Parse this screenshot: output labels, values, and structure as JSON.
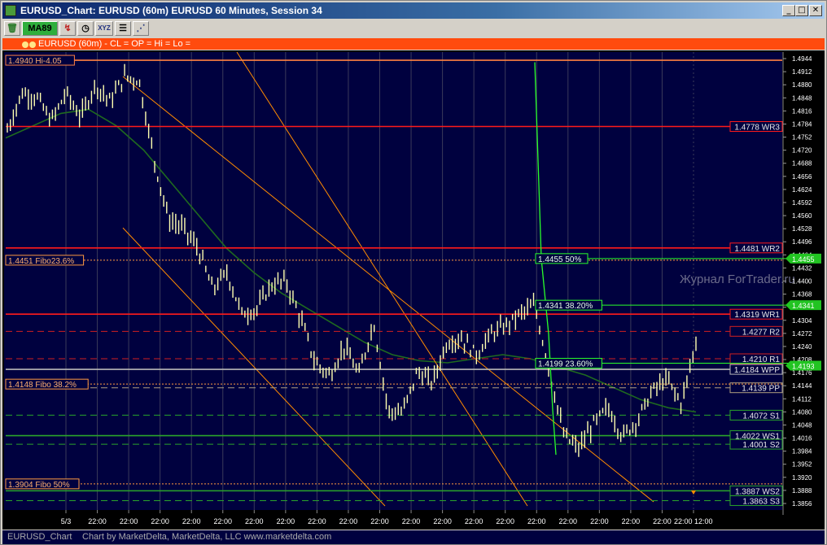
{
  "window": {
    "title": "EURUSD_Chart: EURUSD (60m) EURUSD 60 Minutes, Session 34",
    "minimize_glyph": "_",
    "maximize_glyph": "□",
    "close_glyph": "✕"
  },
  "toolbar": {
    "tools": [
      {
        "name": "trash-tool",
        "label": "🗑"
      },
      {
        "name": "ma89-study",
        "label": "MA89"
      },
      {
        "name": "draw-arrow-tool",
        "label": "↯"
      },
      {
        "name": "clock-tool",
        "label": "◷"
      },
      {
        "name": "xyz-tool",
        "label": "XYZ"
      },
      {
        "name": "list-tool",
        "label": "☰"
      },
      {
        "name": "fibonacci-tool",
        "label": "⋰"
      }
    ]
  },
  "study_bar": {
    "label": "EURUSD (60m) - CL = OP = Hi = Lo ="
  },
  "watermark": "Журнал ForTrader.ru",
  "chart_data": {
    "type": "candlestick",
    "symbol": "EURUSD",
    "interval": "60m",
    "y_axis": {
      "ylim": [
        1.384,
        1.496
      ],
      "ticks": [
        "1.4944",
        "1.4912",
        "1.4880",
        "1.4848",
        "1.4816",
        "1.4784",
        "1.4752",
        "1.4720",
        "1.4688",
        "1.4656",
        "1.4624",
        "1.4592",
        "1.4560",
        "1.4528",
        "1.4496",
        "1.4464",
        "1.4432",
        "1.4400",
        "1.4368",
        "1.4336",
        "1.4304",
        "1.4272",
        "1.4240",
        "1.4208",
        "1.4176",
        "1.4144",
        "1.4112",
        "1.4080",
        "1.4048",
        "1.4016",
        "1.3984",
        "1.3952",
        "1.3920",
        "1.3888",
        "1.3856"
      ]
    },
    "x_axis": {
      "ticks": [
        "5/3",
        "22:00",
        "22:00",
        "22:00",
        "22:00",
        "22:00",
        "22:00",
        "22:00",
        "22:00",
        "22:00",
        "22:00",
        "22:00",
        "22:00",
        "22:00",
        "22:00",
        "22:00",
        "22:00",
        "22:00",
        "22:00",
        "22:00",
        "22:00 12:00"
      ]
    },
    "series_sketch": [
      1.477,
      1.486,
      1.485,
      1.479,
      1.486,
      1.48,
      1.488,
      1.484,
      1.49,
      1.489,
      1.47,
      1.455,
      1.453,
      1.448,
      1.438,
      1.442,
      1.432,
      1.433,
      1.439,
      1.44,
      1.431,
      1.42,
      1.417,
      1.424,
      1.417,
      1.43,
      1.408,
      1.408,
      1.418,
      1.415,
      1.425,
      1.426,
      1.422,
      1.427,
      1.429,
      1.432,
      1.434,
      1.418,
      1.402,
      1.399,
      1.405,
      1.409,
      1.402,
      1.406,
      1.413,
      1.416,
      1.41,
      1.425
    ],
    "moving_average_sketch": [
      1.475,
      1.478,
      1.481,
      1.482,
      1.478,
      1.472,
      1.464,
      1.456,
      1.448,
      1.442,
      1.437,
      1.433,
      1.429,
      1.425,
      1.422,
      1.4205,
      1.42,
      1.421,
      1.422,
      1.421,
      1.419,
      1.417,
      1.414,
      1.411,
      1.409,
      1.408
    ],
    "levels": [
      {
        "label": "1.4778 WR3",
        "price": 1.4778,
        "color": "#ff1a1a",
        "style": "solid",
        "side": "right"
      },
      {
        "label": "1.4481 WR2",
        "price": 1.4481,
        "color": "#ff1a1a",
        "style": "solid",
        "side": "right"
      },
      {
        "label": "1.4319 WR1",
        "price": 1.4319,
        "color": "#ff1a1a",
        "style": "solid",
        "side": "right"
      },
      {
        "label": "1.4277 R2",
        "price": 1.4277,
        "color": "#d02020",
        "style": "dashed",
        "side": "right"
      },
      {
        "label": "1.4210 R1",
        "price": 1.421,
        "color": "#d02020",
        "style": "dashed",
        "side": "right"
      },
      {
        "label": "1.4184 WPP",
        "price": 1.4184,
        "color": "#b8b8b8",
        "style": "solid",
        "side": "right"
      },
      {
        "label": "1.4139 PP",
        "price": 1.4139,
        "color": "#b0a080",
        "style": "dashed",
        "side": "right"
      },
      {
        "label": "1.4072 S1",
        "price": 1.4072,
        "color": "#2aa52a",
        "style": "dashed",
        "side": "right"
      },
      {
        "label": "1.4022 WS1",
        "price": 1.4022,
        "color": "#2aa52a",
        "style": "solid",
        "side": "right"
      },
      {
        "label": "1.4001 S2",
        "price": 1.4001,
        "color": "#2aa52a",
        "style": "dashed",
        "side": "right"
      },
      {
        "label": "1.3887 WS2",
        "price": 1.3887,
        "color": "#2aa52a",
        "style": "solid",
        "side": "right"
      },
      {
        "label": "1.3863 S3",
        "price": 1.3863,
        "color": "#2aa52a",
        "style": "dashed",
        "side": "right"
      },
      {
        "label": "1.4940 Hi-4.05",
        "price": 1.494,
        "color": "#ff8040",
        "style": "solid",
        "side": "left"
      },
      {
        "label": "1.4451 Fibo23.6%",
        "price": 1.4451,
        "color": "#ff9a40",
        "style": "dotted",
        "side": "left"
      },
      {
        "label": "1.4148 Fibo 38.2%",
        "price": 1.4148,
        "color": "#ff9a40",
        "style": "dotted",
        "side": "left"
      },
      {
        "label": "1.3904 Fibo 50%",
        "price": 1.3904,
        "color": "#ff9a40",
        "style": "dotted",
        "side": "left"
      }
    ],
    "fib_retracement": [
      {
        "label": "1.4455 50%",
        "price": 1.4455
      },
      {
        "label": "1.4341 38.20%",
        "price": 1.4341
      },
      {
        "label": "1.4199 23.60%",
        "price": 1.4199
      }
    ],
    "price_tags": [
      {
        "label": "1.4455",
        "price": 1.4455
      },
      {
        "label": "1.4341",
        "price": 1.4341
      },
      {
        "label": "1.4193",
        "price": 1.4193
      }
    ],
    "grid": true
  },
  "status": {
    "chart_name": "EURUSD_Chart",
    "credit": "Chart by MarketDelta, MarketDelta, LLC www.marketdelta.com"
  },
  "colors": {
    "background": "#000000",
    "plot_area": "#00013f",
    "grid": "#3a3a5a",
    "candles": "#ffffb0",
    "moving_average": "#1f6a1f",
    "channel": "#ff8c00",
    "fib_line": "#2aff2a",
    "accent": "#ff4b0e"
  }
}
